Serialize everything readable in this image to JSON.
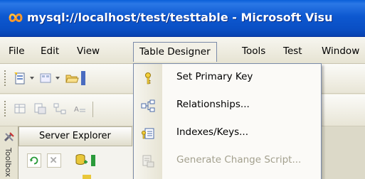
{
  "window": {
    "title": "mysql://localhost/test/testtable - Microsoft Visu"
  },
  "menubar": {
    "items": [
      {
        "label": "File"
      },
      {
        "label": "Edit"
      },
      {
        "label": "View"
      },
      {
        "label": "Table Designer",
        "active": true
      },
      {
        "label": "Tools"
      },
      {
        "label": "Test"
      },
      {
        "label": "Window"
      }
    ]
  },
  "dropdown": {
    "items": [
      {
        "label": "Set Primary Key",
        "icon": "key-icon",
        "enabled": true
      },
      {
        "label": "Relationships...",
        "icon": "relationships-icon",
        "enabled": true
      },
      {
        "label": "Indexes/Keys...",
        "icon": "indexes-icon",
        "enabled": true
      },
      {
        "label": "Generate Change Script...",
        "icon": "script-icon",
        "enabled": false
      }
    ]
  },
  "server_explorer": {
    "title": "Server Explorer",
    "side_tab": "Toolbox"
  },
  "colors": {
    "titlebar": "#0a4fc4",
    "menu_highlight_border": "#7a8aa8",
    "disabled_text": "#a3a08e"
  }
}
